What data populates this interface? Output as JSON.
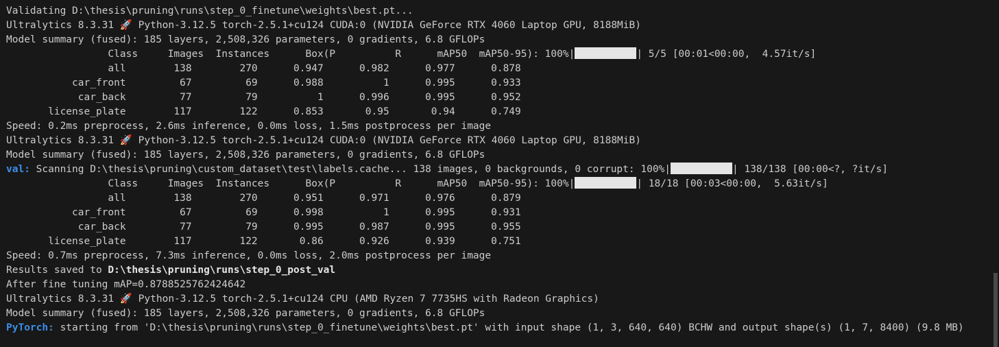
{
  "terminal": {
    "lines": [
      "Validating D:\\thesis\\pruning\\runs\\step_0_finetune\\weights\\best.pt...",
      "",
      "Model summary (fused): 185 layers, 2,508,326 parameters, 0 gradients, 6.8 GFLOPs",
      "",
      "                 all        138        270      0.947      0.982      0.977      0.878",
      "           car_front         67         69      0.988          1      0.995      0.933",
      "            car_back         77         79          1      0.996      0.995      0.952",
      "       license_plate        117        122      0.853       0.95       0.94      0.749",
      "Speed: 0.2ms preprocess, 2.6ms inference, 0.0ms loss, 1.5ms postprocess per image",
      "",
      "Model summary (fused): 185 layers, 2,508,326 parameters, 0 gradients, 6.8 GFLOPs",
      "",
      "",
      "                 all        138        270      0.951      0.971      0.976      0.879",
      "           car_front         67         69      0.998          1      0.995      0.931",
      "            car_back         77         79      0.995      0.987      0.995      0.955",
      "       license_plate        117        122       0.86      0.926      0.939      0.751",
      "Speed: 0.7ms preprocess, 7.3ms inference, 0.0ms loss, 2.0ms postprocess per image",
      "",
      "After fine tuning mAP=0.8788525762424642",
      "",
      "Model summary (fused): 185 layers, 2,508,326 parameters, 0 gradients, 6.8 GFLOPs",
      ""
    ],
    "ultra1_a": "Ultralytics 8.3.31 ",
    "ultra1_b": " Python-3.12.5 torch-2.5.1+cu124 CUDA:0 (NVIDIA GeForce RTX 4060 Laptop GPU, 8188MiB)",
    "ultra2_a": "Ultralytics 8.3.31 ",
    "ultra2_b": " Python-3.12.5 torch-2.5.1+cu124 CUDA:0 (NVIDIA GeForce RTX 4060 Laptop GPU, 8188MiB)",
    "ultra3_a": "Ultralytics 8.3.31 ",
    "ultra3_b": " Python-3.12.5 torch-2.5.1+cu124 CPU (AMD Ryzen 7 7735HS with Radeon Graphics)",
    "rocket_glyph": "🚀",
    "header1_a": "                 Class     Images  Instances      Box(P          R      mAP50  mAP50-95): 100%|",
    "header1_b": "| 5/5 [00:01<00:00,  4.57it/s]",
    "header2_a": "                 Class     Images  Instances      Box(P          R      mAP50  mAP50-95): 100%|",
    "header2_b": "| 18/18 [00:03<00:00,  5.63it/s]",
    "val_label": "val:",
    "val_a": " Scanning D:\\thesis\\pruning\\custom_dataset\\test\\labels.cache... 138 images, 0 backgrounds, 0 corrupt: 100%|",
    "val_b": "| 138/138 [00:00<?, ?it/s]",
    "results_a": "Results saved to ",
    "results_path": "D:\\thesis\\pruning\\runs\\step_0_post_val",
    "pytorch_label": "PyTorch:",
    "pytorch_text": " starting from 'D:\\thesis\\pruning\\runs\\step_0_finetune\\weights\\best.pt' with input shape (1, 3, 640, 640) BCHW and output shape(s) (1, 7, 8400) (9.8 MB)"
  },
  "colors": {
    "background": "#181818",
    "text": "#cccccc",
    "accent_blue": "#3b8eea",
    "bar": "#e5e5e5"
  }
}
